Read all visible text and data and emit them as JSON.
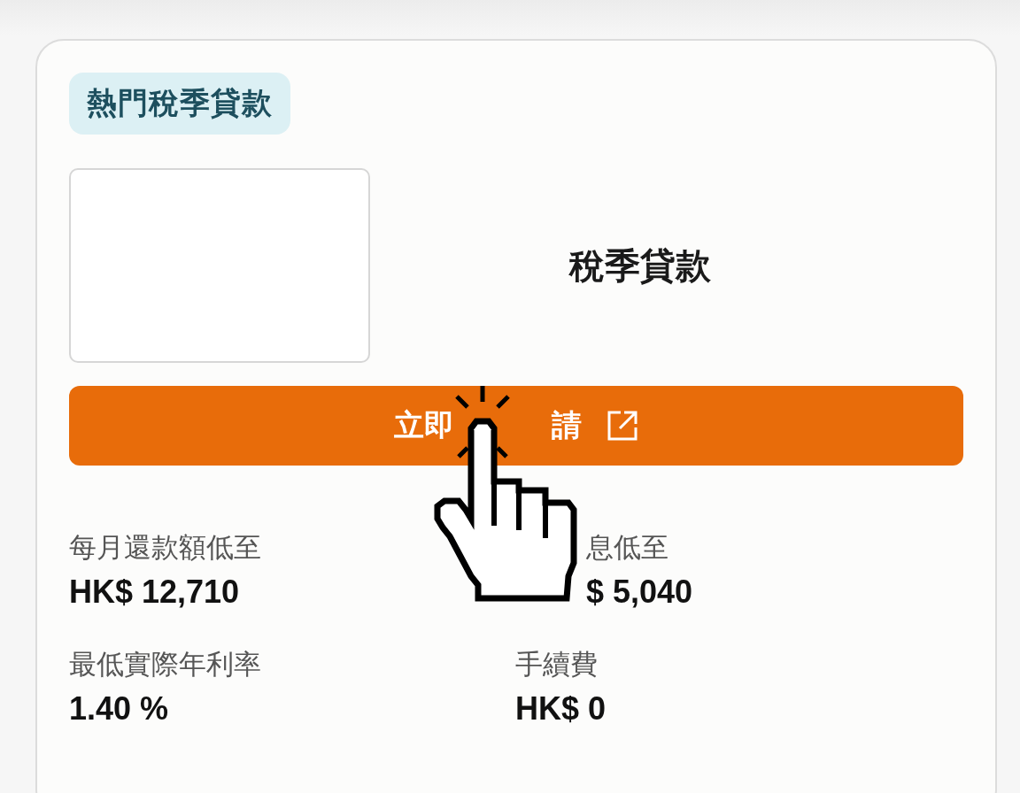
{
  "card": {
    "badge": "熱門稅季貸款",
    "title": "稅季貸款",
    "apply_button": {
      "label_parts": [
        "立即",
        "請"
      ]
    },
    "stats": [
      {
        "label": "每月還款額低至",
        "value": "HK$ 12,710"
      },
      {
        "label": "息低至",
        "value": "$ 5,040"
      },
      {
        "label": "最低實際年利率",
        "value": "1.40 %"
      },
      {
        "label": "手續費",
        "value": "HK$ 0"
      }
    ]
  }
}
